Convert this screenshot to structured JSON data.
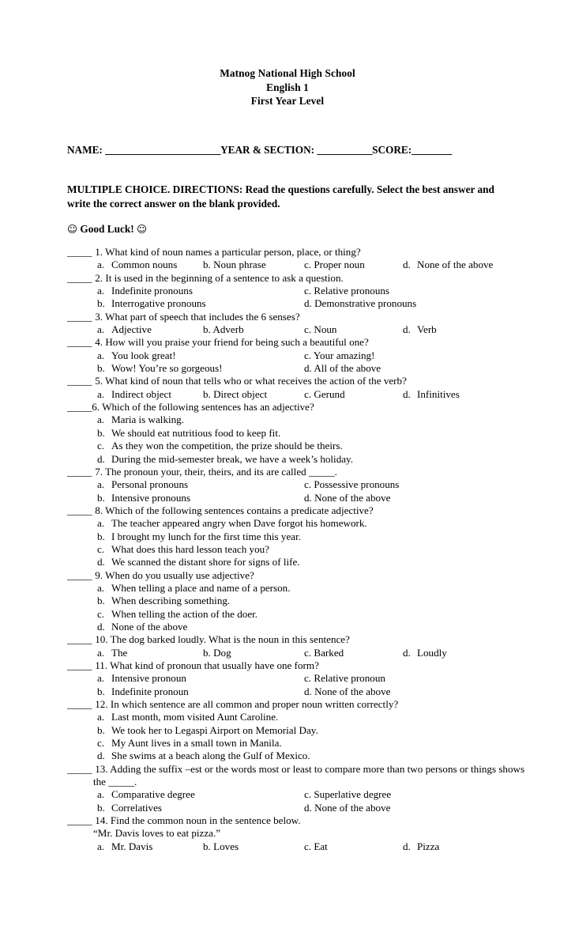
{
  "header": {
    "school": "Matnog National High School",
    "subject": "English 1",
    "level": "First Year Level"
  },
  "name_line": {
    "name_label": "NAME: ",
    "name_blank": "_______________________",
    "year_section_label": "YEAR & SECTION: ",
    "year_section_blank": "___________",
    "score_label": "SCORE:",
    "score_blank": "________"
  },
  "directions": {
    "text": "MULTIPLE CHOICE. DIRECTIONS: Read the questions carefully. Select the best answer and write the correct answer on the blank provided."
  },
  "good_luck": {
    "left_icon": "☺",
    "text": "Good Luck!",
    "right_icon": "☺"
  },
  "questions": [
    {
      "blank": "_____",
      "number": "1.",
      "text": "What kind of noun names a particular person, place, or thing?",
      "layout": "four-column",
      "options": [
        {
          "letter": "a.",
          "text": "Common nouns"
        },
        {
          "letter": "b.",
          "text": "Noun phrase"
        },
        {
          "letter": "c.",
          "text": "Proper noun"
        },
        {
          "letter": "d.",
          "text": "None of the above"
        }
      ]
    },
    {
      "blank": "_____",
      "number": "2.",
      "text": "It is used in the beginning of a sentence to ask a question.",
      "layout": "two-column",
      "options": [
        {
          "letter": "a.",
          "text": "Indefinite pronouns"
        },
        {
          "letter": "b.",
          "text": "Interrogative pronouns"
        },
        {
          "letter": "c.",
          "text": "Relative pronouns"
        },
        {
          "letter": "d.",
          "text": "Demonstrative pronouns"
        }
      ]
    },
    {
      "blank": "_____",
      "number": "3.",
      "text": "What part of speech that includes the 6 senses?",
      "layout": "four-column",
      "options": [
        {
          "letter": "a.",
          "text": "Adjective"
        },
        {
          "letter": "b.",
          "text": "Adverb"
        },
        {
          "letter": "c.",
          "text": "Noun"
        },
        {
          "letter": "d.",
          "text": "Verb"
        }
      ]
    },
    {
      "blank": "_____",
      "number": "4.",
      "text": "How will you praise your friend for being such a beautiful one?",
      "layout": "two-column",
      "options": [
        {
          "letter": "a.",
          "text": "You look great!"
        },
        {
          "letter": "b.",
          "text": "Wow! You’re so gorgeous!"
        },
        {
          "letter": "c.",
          "text": "Your amazing!"
        },
        {
          "letter": "d.",
          "text": "All of the above"
        }
      ]
    },
    {
      "blank": "_____",
      "number": "5.",
      "text": "What kind of noun that tells who or what receives the action of the verb?",
      "layout": "four-column",
      "options": [
        {
          "letter": "a.",
          "text": "Indirect object"
        },
        {
          "letter": "b.",
          "text": "Direct object"
        },
        {
          "letter": "c.",
          "text": "Gerund"
        },
        {
          "letter": "d.",
          "text": "Infinitives"
        }
      ]
    },
    {
      "blank": "_____",
      "number": "6.",
      "text": "Which of the following sentences has an adjective?",
      "layout": "stacked",
      "no_gap": true,
      "options": [
        {
          "letter": "a.",
          "text": "Maria is walking."
        },
        {
          "letter": "b.",
          "text": "We should eat nutritious food to keep fit."
        },
        {
          "letter": "c.",
          "text": "As they won the competition, the prize should be theirs."
        },
        {
          "letter": "d.",
          "text": "During the mid-semester break, we have a week’s holiday."
        }
      ]
    },
    {
      "blank": "_____",
      "number": "7.",
      "text": "The pronoun your, their, theirs, and its are called _____.",
      "layout": "two-column",
      "options": [
        {
          "letter": "a.",
          "text": "Personal pronouns"
        },
        {
          "letter": "b.",
          "text": "Intensive pronouns"
        },
        {
          "letter": "c.",
          "text": "Possessive pronouns"
        },
        {
          "letter": "d.",
          "text": "None of the above"
        }
      ]
    },
    {
      "blank": "_____",
      "number": "8.",
      "text": "Which of the following sentences contains a predicate adjective?",
      "layout": "stacked",
      "options": [
        {
          "letter": "a.",
          "text": "The teacher appeared angry when Dave forgot his homework."
        },
        {
          "letter": "b.",
          "text": "I brought my lunch for the first time this year."
        },
        {
          "letter": "c.",
          "text": "What does this hard lesson teach you?"
        },
        {
          "letter": "d.",
          "text": "We scanned the distant shore for signs of life."
        }
      ]
    },
    {
      "blank": "_____",
      "number": "9.",
      "text": "When do you usually use adjective?",
      "layout": "stacked",
      "options": [
        {
          "letter": "a.",
          "text": "When telling a place and name of a person."
        },
        {
          "letter": "b.",
          "text": "When describing something."
        },
        {
          "letter": "c.",
          "text": "When telling the action of the doer."
        },
        {
          "letter": "d.",
          "text": "None of the above"
        }
      ]
    },
    {
      "blank": "_____",
      "number": "10.",
      "text": "The dog barked loudly. What is the noun in this sentence?",
      "layout": "four-column",
      "options": [
        {
          "letter": "a.",
          "text": "The"
        },
        {
          "letter": "b.",
          "text": "Dog"
        },
        {
          "letter": "c.",
          "text": "Barked"
        },
        {
          "letter": "d.",
          "text": "Loudly"
        }
      ]
    },
    {
      "blank": "_____",
      "number": "11.",
      "text": "What kind of pronoun that usually have one form?",
      "layout": "two-column",
      "options": [
        {
          "letter": "a.",
          "text": "Intensive pronoun"
        },
        {
          "letter": "b.",
          "text": "Indefinite pronoun"
        },
        {
          "letter": "c.",
          "text": "Relative pronoun"
        },
        {
          "letter": "d.",
          "text": "None of the above"
        }
      ]
    },
    {
      "blank": "_____",
      "number": "12.",
      "text": "In which sentence are all common and proper noun written correctly?",
      "layout": "stacked",
      "options": [
        {
          "letter": "a.",
          "text": "Last month, mom visited Aunt Caroline."
        },
        {
          "letter": "b.",
          "text": "We took her to Legaspi Airport on Memorial Day."
        },
        {
          "letter": "c.",
          "text": "My Aunt lives in a small town in Manila."
        },
        {
          "letter": "d.",
          "text": "She swims at a beach along the Gulf of Mexico."
        }
      ]
    },
    {
      "blank": "_____",
      "number": "13.",
      "text": "Adding the suffix –est or the words most or least to compare more than two persons or things  shows the _____.",
      "layout": "two-column",
      "wraps": true,
      "options": [
        {
          "letter": "a.",
          "text": "Comparative degree"
        },
        {
          "letter": "b.",
          "text": "Correlatives"
        },
        {
          "letter": "c.",
          "text": "Superlative degree"
        },
        {
          "letter": "d.",
          "text": "None of the above"
        }
      ]
    },
    {
      "blank": "_____",
      "number": "14.",
      "text": "Find the common noun in the sentence below.",
      "quoted_sentence": "“Mr. Davis loves to eat pizza.”",
      "layout": "four-column",
      "options": [
        {
          "letter": "a.",
          "text": "Mr. Davis"
        },
        {
          "letter": "b.",
          "text": "Loves"
        },
        {
          "letter": "c.",
          "text": "Eat"
        },
        {
          "letter": "d.",
          "text": "Pizza"
        }
      ]
    }
  ]
}
